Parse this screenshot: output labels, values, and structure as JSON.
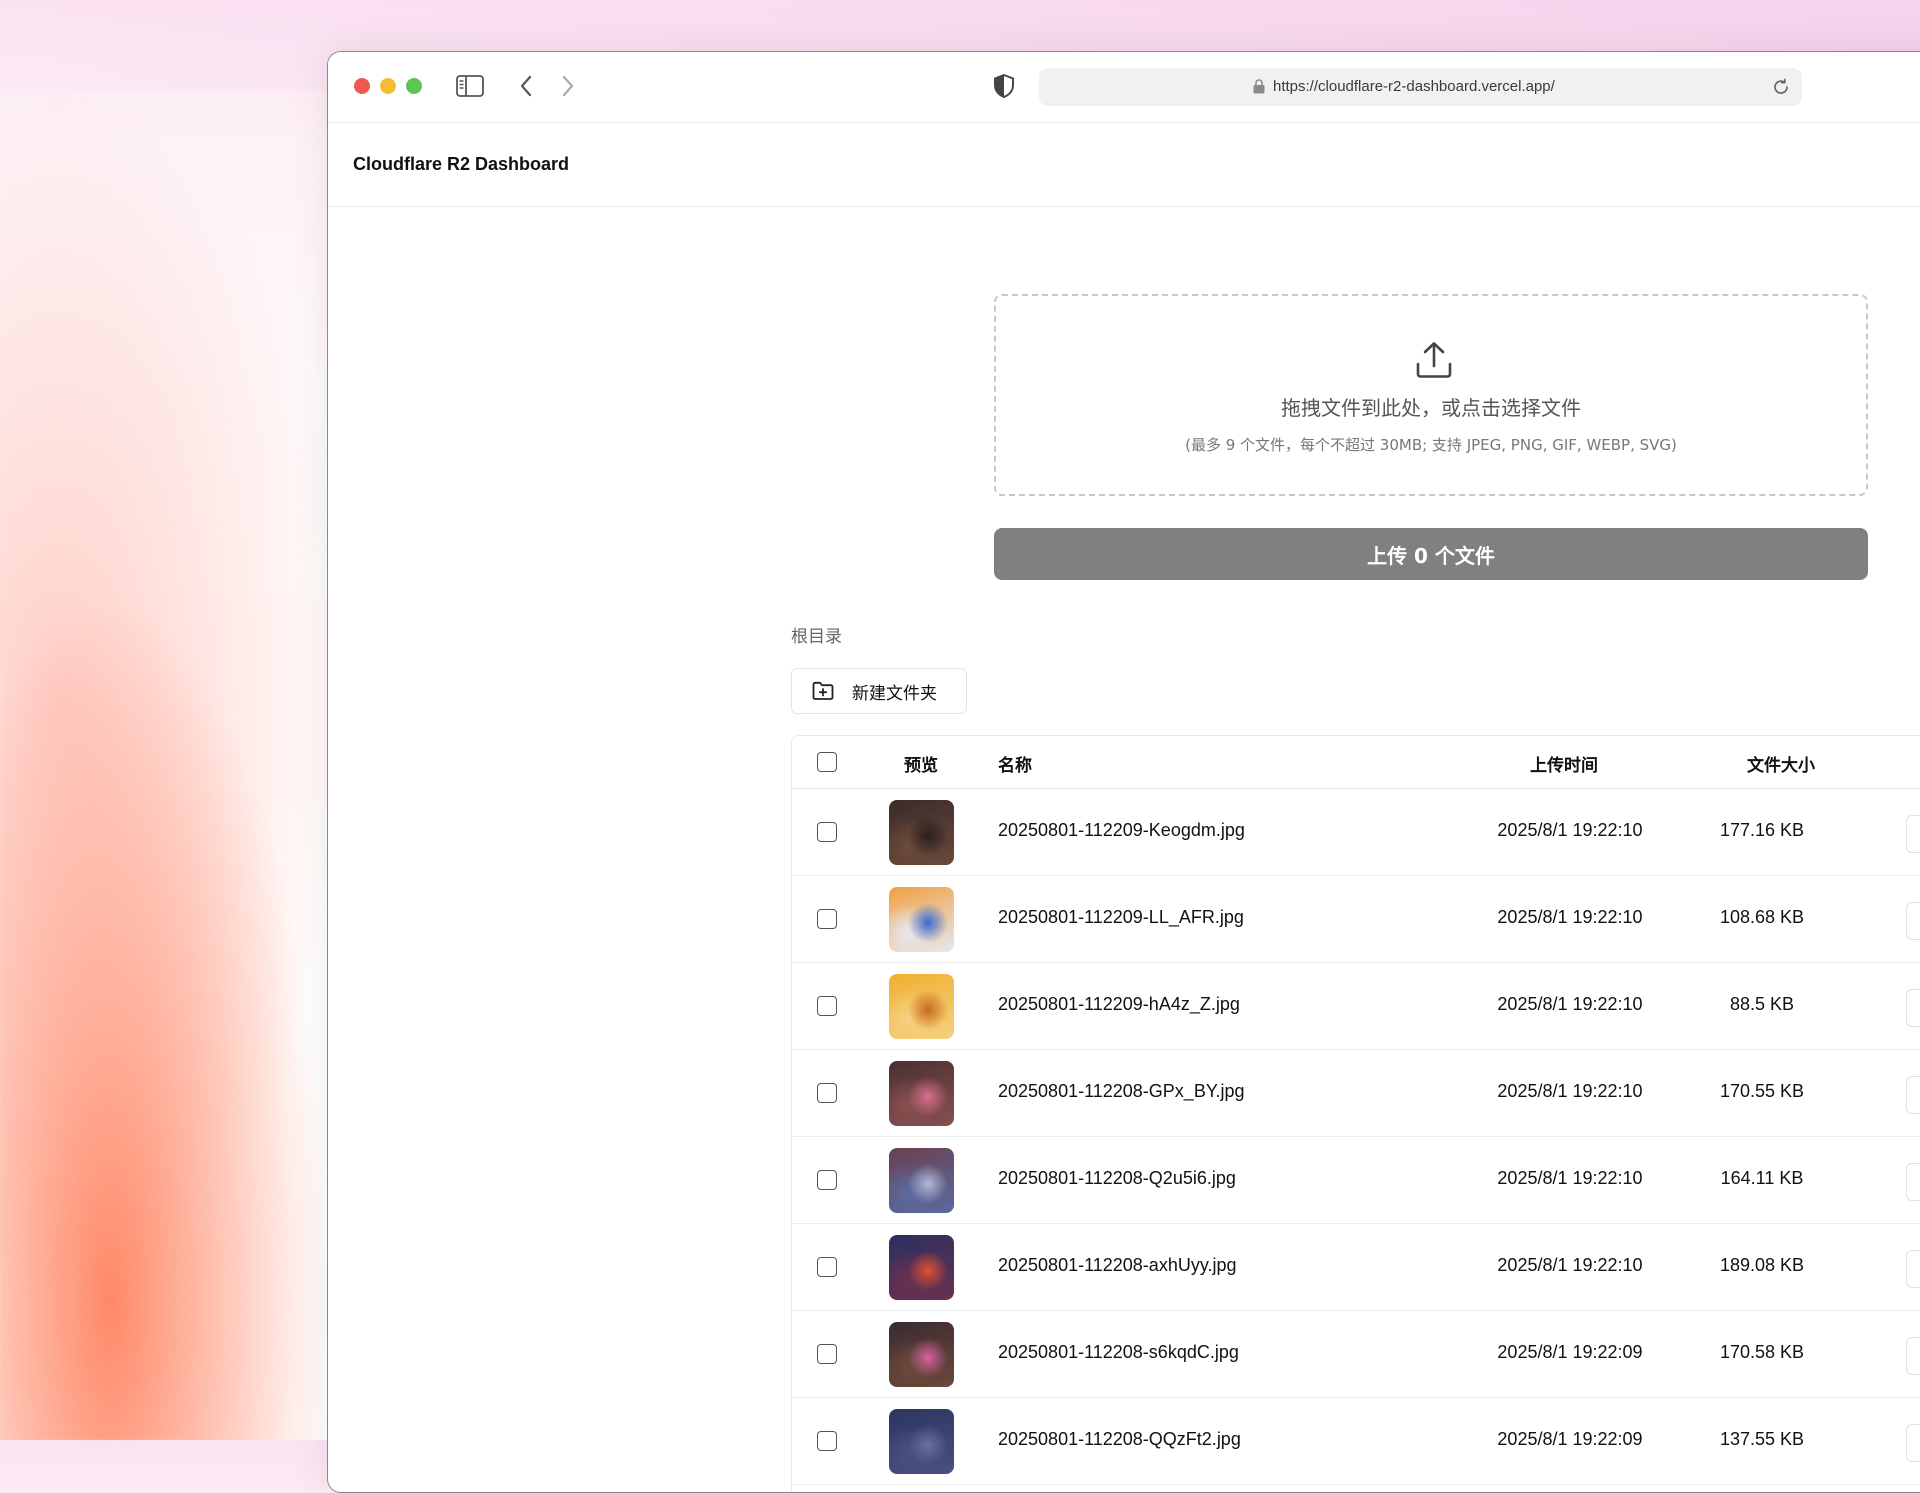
{
  "browser": {
    "url": "https://cloudflare-r2-dashboard.vercel.app/"
  },
  "app": {
    "title": "Cloudflare R2 Dashboard"
  },
  "dropzone": {
    "title": "拖拽文件到此处，或点击选择文件",
    "hint": "(最多 9 个文件，每个不超过 30MB; 支持 JPEG, PNG, GIF, WEBP, SVG)"
  },
  "upload_button": "上传 0 个文件",
  "breadcrumb": "根目录",
  "new_folder_button": "新建文件夹",
  "table": {
    "headers": {
      "preview": "预览",
      "name": "名称",
      "time": "上传时间",
      "size": "文件大小"
    },
    "rows": [
      {
        "name": "20250801-112209-Keogdm.jpg",
        "time": "2025/8/1 19:22:10",
        "size": "177.16 KB",
        "thumb_colors": [
          "#3a2a2a",
          "#6b4a3a",
          "#2c1f1f"
        ]
      },
      {
        "name": "20250801-112209-LL_AFR.jpg",
        "time": "2025/8/1 19:22:10",
        "size": "108.68 KB",
        "thumb_colors": [
          "#f0a040",
          "#e8e8f0",
          "#3a6ad0"
        ]
      },
      {
        "name": "20250801-112209-hA4z_Z.jpg",
        "time": "2025/8/1 19:22:10",
        "size": "88.5 KB",
        "thumb_colors": [
          "#f0b030",
          "#f5d080",
          "#c86a20"
        ]
      },
      {
        "name": "20250801-112208-GPx_BY.jpg",
        "time": "2025/8/1 19:22:10",
        "size": "170.55 KB",
        "thumb_colors": [
          "#4a3030",
          "#8a5050",
          "#d87090"
        ]
      },
      {
        "name": "20250801-112208-Q2u5i6.jpg",
        "time": "2025/8/1 19:22:10",
        "size": "164.11 KB",
        "thumb_colors": [
          "#6a4050",
          "#5a6aa0",
          "#b0b8d8"
        ]
      },
      {
        "name": "20250801-112208-axhUyy.jpg",
        "time": "2025/8/1 19:22:10",
        "size": "189.08 KB",
        "thumb_colors": [
          "#2a3060",
          "#6a3050",
          "#e05030"
        ]
      },
      {
        "name": "20250801-112208-s6kqdC.jpg",
        "time": "2025/8/1 19:22:09",
        "size": "170.58 KB",
        "thumb_colors": [
          "#3a2a30",
          "#6a4a3a",
          "#d860a0"
        ]
      },
      {
        "name": "20250801-112208-QQzFt2.jpg",
        "time": "2025/8/1 19:22:09",
        "size": "137.55 KB",
        "thumb_colors": [
          "#2a3560",
          "#4a5080",
          "#6a70a0"
        ]
      }
    ]
  }
}
